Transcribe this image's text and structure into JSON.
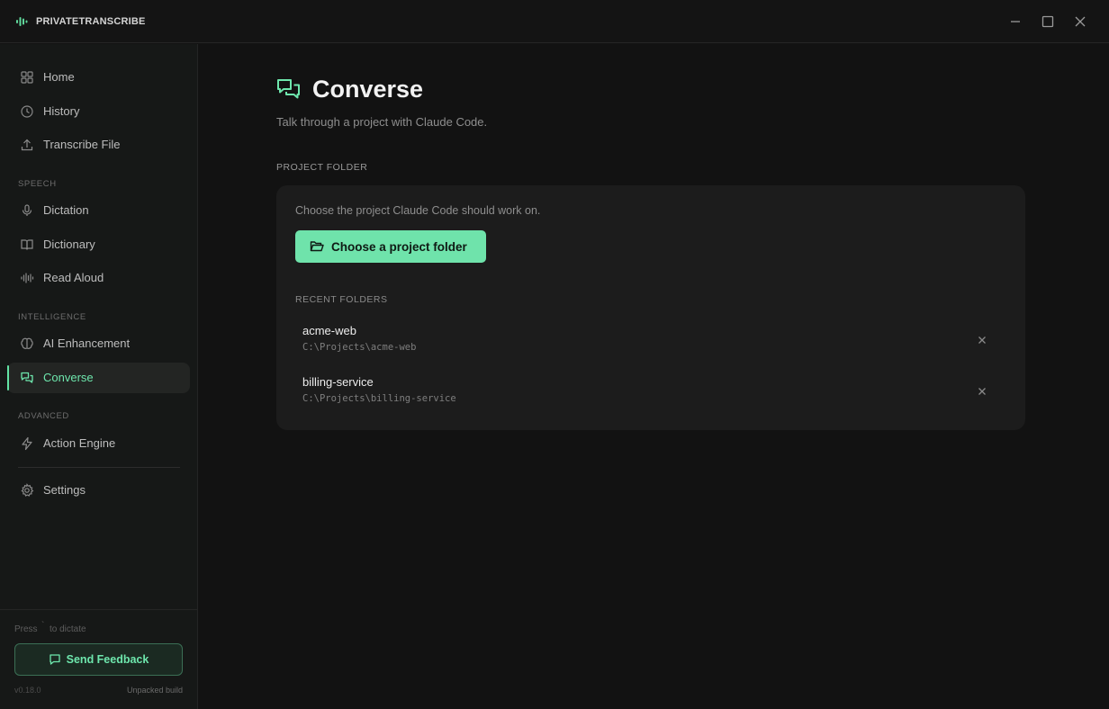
{
  "app": {
    "name": "PRIVATETRANSCRIBE",
    "accent": "#6fe3ab"
  },
  "sidebar": {
    "top_items": [
      {
        "label": "Home",
        "icon": "grid-icon"
      },
      {
        "label": "History",
        "icon": "clock-icon"
      },
      {
        "label": "Transcribe File",
        "icon": "upload-icon"
      }
    ],
    "sections": {
      "speech": "SPEECH",
      "intelligence": "INTELLIGENCE",
      "advanced": "ADVANCED"
    },
    "speech_items": [
      {
        "label": "Dictation",
        "icon": "microphone-icon"
      },
      {
        "label": "Dictionary",
        "icon": "book-icon"
      },
      {
        "label": "Read Aloud",
        "icon": "waveform-icon"
      }
    ],
    "intelligence_items": [
      {
        "label": "AI Enhancement",
        "icon": "brain-icon"
      },
      {
        "label": "Converse",
        "icon": "chat-icon",
        "active": true
      }
    ],
    "advanced_items": [
      {
        "label": "Action Engine",
        "icon": "lightning-icon"
      }
    ],
    "settings_label": "Settings",
    "footer": {
      "hint_prefix": "Press",
      "hint_key": "`",
      "hint_suffix": "to dictate",
      "feedback_label": "Send Feedback",
      "version": "v0.18.0",
      "build": "Unpacked build"
    }
  },
  "main": {
    "title": "Converse",
    "subtitle": "Talk through a project with Claude Code.",
    "folder_section_label": "PROJECT FOLDER",
    "card_description": "Choose the project Claude Code should work on.",
    "choose_button_label": "Choose a project folder",
    "recent_label": "RECENT FOLDERS",
    "recent_folders": [
      {
        "name": "acme-web",
        "path": "C:\\Projects\\acme-web"
      },
      {
        "name": "billing-service",
        "path": "C:\\Projects\\billing-service"
      }
    ]
  }
}
